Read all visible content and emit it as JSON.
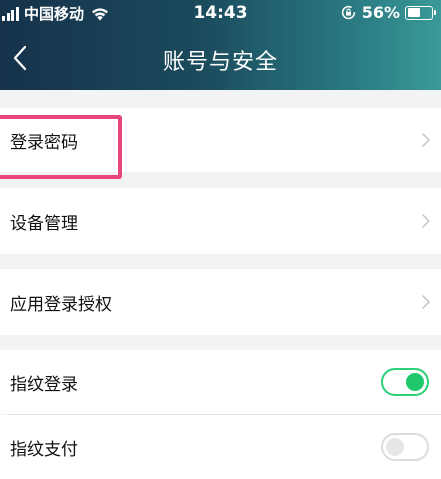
{
  "status_bar": {
    "carrier": "中国移动",
    "time": "14:43",
    "battery": "56%",
    "battery_level": 0.56,
    "icons": [
      "signal-icon",
      "wifi-icon",
      "rotation-lock-icon",
      "battery-icon"
    ]
  },
  "header": {
    "title": "账号与安全",
    "back_icon": "chevron-left-icon"
  },
  "rows": {
    "login_password": "登录密码",
    "device_management": "设备管理",
    "app_login_auth": "应用登录授权",
    "fingerprint_login": "指纹登录",
    "fingerprint_pay": "指纹支付"
  },
  "toggles": {
    "fingerprint_login": true,
    "fingerprint_pay": false
  },
  "colors": {
    "header_start": "#16324b",
    "header_end": "#3a9a98",
    "toggle_on": "#1ec86a",
    "highlight": "#e9457f"
  }
}
